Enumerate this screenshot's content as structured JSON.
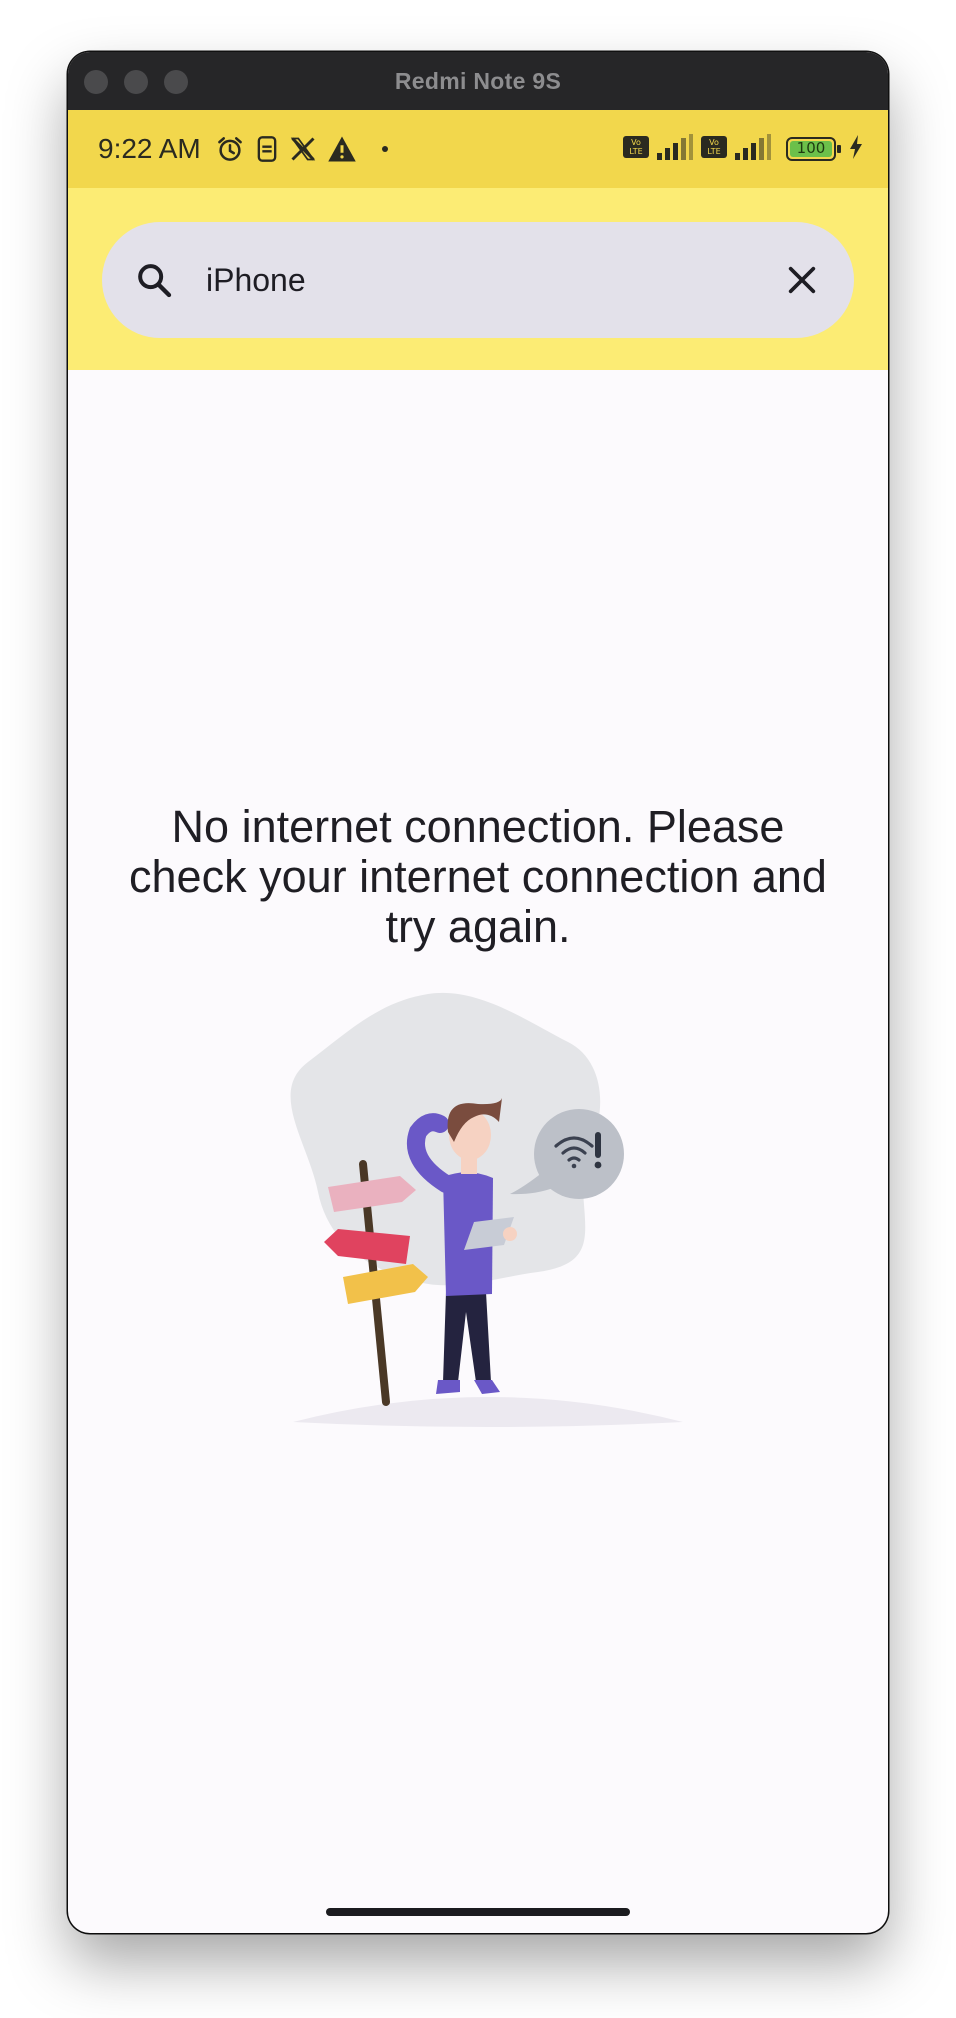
{
  "window": {
    "title": "Redmi Note 9S"
  },
  "status_bar": {
    "time": "9:22 AM",
    "left_icons": [
      "alarm-icon",
      "data-saver-icon",
      "x-logo-icon",
      "warning-icon",
      "dot-icon"
    ],
    "volte_label": "Vo LTE",
    "battery": "100",
    "colors": {
      "bar": "#f2d74c",
      "battery_fill": "#6cc04a"
    }
  },
  "app_bar": {
    "background": "#fcec74"
  },
  "search": {
    "value": "iPhone",
    "icon": "search-icon",
    "clear_icon": "close-icon"
  },
  "main": {
    "message": "No internet connection. Please check your internet connection and try again.",
    "illustration": "no-internet-illustration"
  }
}
